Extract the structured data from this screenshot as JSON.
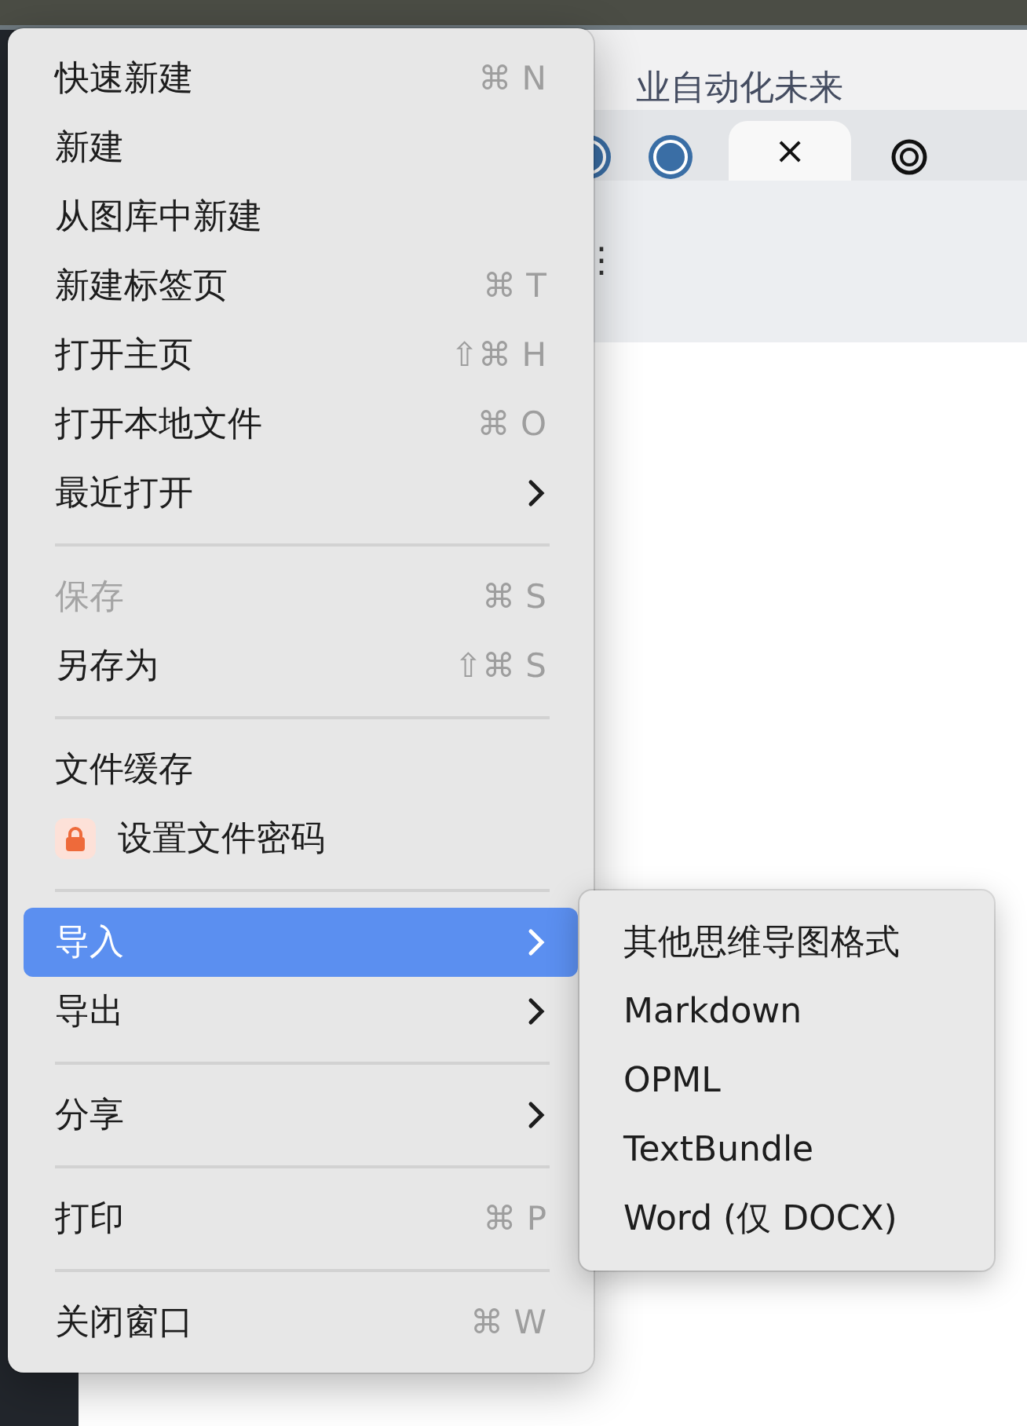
{
  "background": {
    "headline": "业自动化未来",
    "tabs": [
      {
        "kind": "wp",
        "selected": false
      },
      {
        "kind": "wp",
        "selected": false
      },
      {
        "kind": "close",
        "label": "×",
        "selected": true
      },
      {
        "kind": "knot",
        "selected": false
      }
    ],
    "more": "⋮"
  },
  "menu": {
    "items": [
      {
        "kind": "item",
        "label": "快速新建",
        "shortcut": "⌘ N",
        "disabled": false,
        "selected": false,
        "submenu": false
      },
      {
        "kind": "item",
        "label": "新建",
        "disabled": false,
        "selected": false,
        "submenu": false
      },
      {
        "kind": "item",
        "label": "从图库中新建",
        "disabled": false,
        "selected": false,
        "submenu": false
      },
      {
        "kind": "item",
        "label": "新建标签页",
        "shortcut": "⌘ T",
        "disabled": false,
        "selected": false,
        "submenu": false
      },
      {
        "kind": "item",
        "label": "打开主页",
        "shortcut": "⇧⌘ H",
        "disabled": false,
        "selected": false,
        "submenu": false
      },
      {
        "kind": "item",
        "label": "打开本地文件",
        "shortcut": "⌘ O",
        "disabled": false,
        "selected": false,
        "submenu": false
      },
      {
        "kind": "item",
        "label": "最近打开",
        "disabled": false,
        "selected": false,
        "submenu": true
      },
      {
        "kind": "separator"
      },
      {
        "kind": "item",
        "label": "保存",
        "shortcut": "⌘ S",
        "disabled": true,
        "selected": false,
        "submenu": false
      },
      {
        "kind": "item",
        "label": "另存为",
        "shortcut": "⇧⌘ S",
        "disabled": false,
        "selected": false,
        "submenu": false
      },
      {
        "kind": "separator"
      },
      {
        "kind": "item",
        "label": "文件缓存",
        "disabled": false,
        "selected": false,
        "submenu": false
      },
      {
        "kind": "lock_item",
        "label": "设置文件密码",
        "disabled": false,
        "selected": false,
        "submenu": false
      },
      {
        "kind": "separator"
      },
      {
        "kind": "item",
        "label": "导入",
        "disabled": false,
        "selected": true,
        "submenu": true
      },
      {
        "kind": "item",
        "label": "导出",
        "disabled": false,
        "selected": false,
        "submenu": true
      },
      {
        "kind": "separator"
      },
      {
        "kind": "item",
        "label": "分享",
        "disabled": false,
        "selected": false,
        "submenu": true
      },
      {
        "kind": "separator"
      },
      {
        "kind": "item",
        "label": "打印",
        "shortcut": "⌘ P",
        "disabled": false,
        "selected": false,
        "submenu": false
      },
      {
        "kind": "separator"
      },
      {
        "kind": "item",
        "label": "关闭窗口",
        "shortcut": "⌘ W",
        "disabled": false,
        "selected": false,
        "submenu": false
      }
    ]
  },
  "submenu": {
    "items": [
      {
        "label": "其他思维导图格式"
      },
      {
        "label": "Markdown"
      },
      {
        "label": "OPML"
      },
      {
        "label": "TextBundle"
      },
      {
        "label": "Word (仅 DOCX)"
      }
    ]
  }
}
